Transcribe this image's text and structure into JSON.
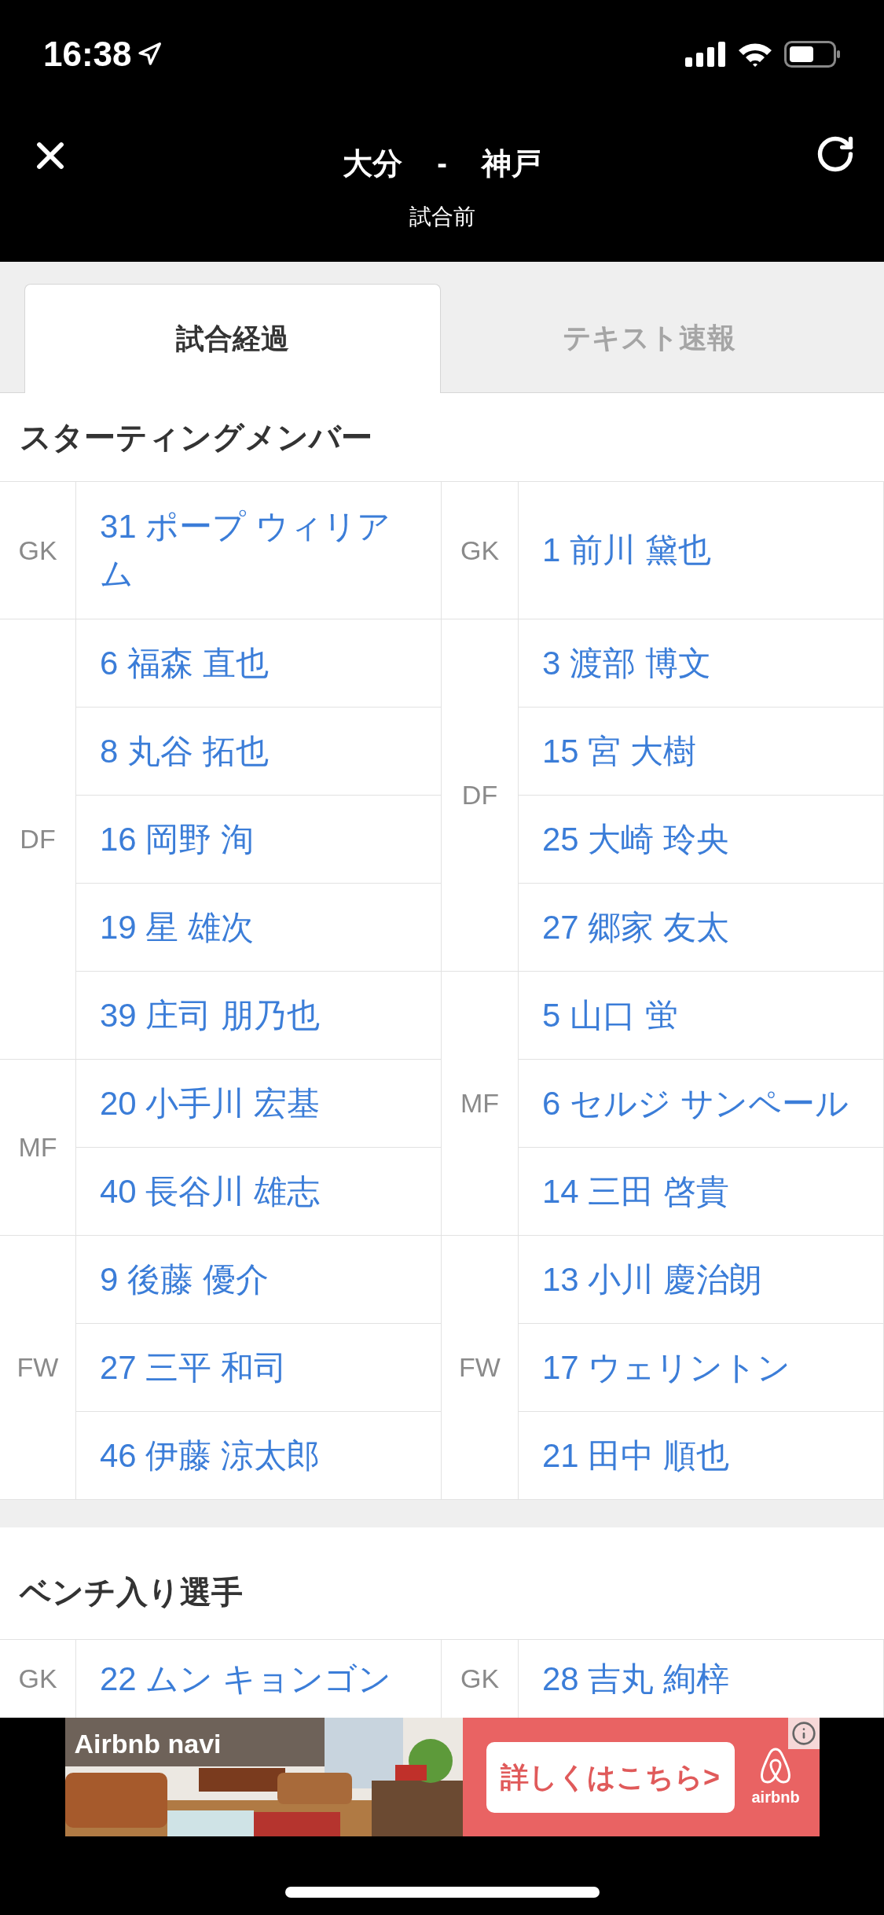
{
  "status_bar": {
    "time": "16:38"
  },
  "header": {
    "title_home": "大分",
    "separator": "-",
    "title_away": "神戸",
    "subtitle": "試合前"
  },
  "tabs": [
    {
      "label": "試合経過",
      "selected": true
    },
    {
      "label": "テキスト速報",
      "selected": false
    }
  ],
  "starting": {
    "heading": "スターティングメンバー",
    "home": [
      {
        "position": "GK",
        "players": [
          "31 ポープ ウィリアム"
        ]
      },
      {
        "position": "DF",
        "players": [
          "6 福森 直也",
          "8 丸谷 拓也",
          "16 岡野 洵",
          "19 星 雄次",
          "39 庄司 朋乃也"
        ]
      },
      {
        "position": "MF",
        "players": [
          "20 小手川 宏基",
          "40 長谷川 雄志"
        ]
      },
      {
        "position": "FW",
        "players": [
          "9 後藤 優介",
          "27 三平 和司",
          "46 伊藤 涼太郎"
        ]
      }
    ],
    "away": [
      {
        "position": "GK",
        "players": [
          "1 前川 黛也"
        ]
      },
      {
        "position": "DF",
        "players": [
          "3 渡部 博文",
          "15 宮 大樹",
          "25 大崎 玲央",
          "27 郷家 友太"
        ]
      },
      {
        "position": "MF",
        "players": [
          "5 山口 蛍",
          "6 セルジ サンペール",
          "14 三田 啓貴"
        ]
      },
      {
        "position": "FW",
        "players": [
          "13 小川 慶治朗",
          "17 ウェリントン",
          "21 田中 順也"
        ]
      }
    ]
  },
  "bench": {
    "heading": "ベンチ入り選手",
    "home": [
      {
        "position": "GK",
        "players": [
          "22 ムン キョンゴン"
        ]
      }
    ],
    "away": [
      {
        "position": "GK",
        "players": [
          "28 吉丸 絢梓"
        ]
      }
    ]
  },
  "ad": {
    "brand": "Airbnb navi",
    "button": "詳しくはこちら>",
    "logo_text": "airbnb"
  }
}
